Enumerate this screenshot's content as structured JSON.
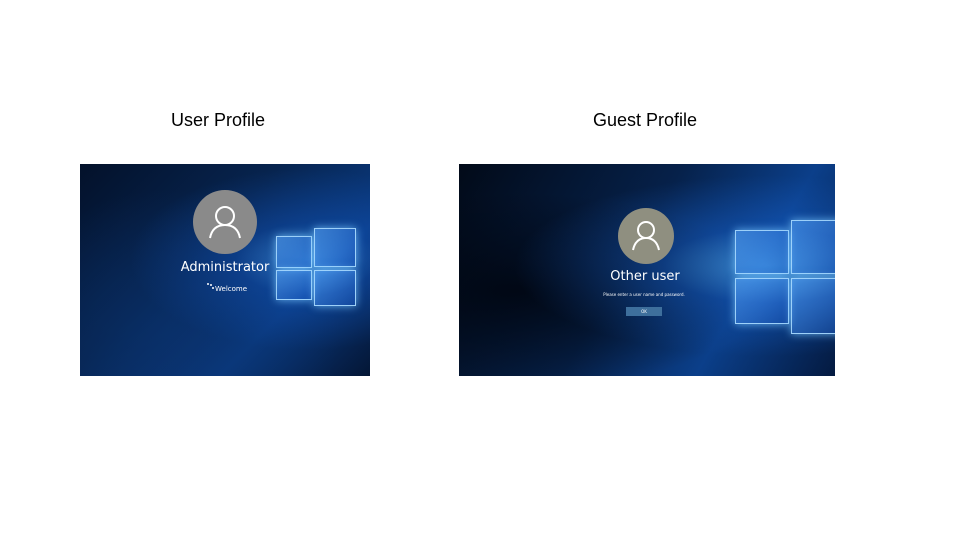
{
  "slide": {
    "user_caption": "User Profile",
    "guest_caption": "Guest Profile"
  },
  "user_screen": {
    "account_name": "Administrator",
    "status": "Welcome",
    "avatar_icon": "user-icon"
  },
  "guest_screen": {
    "account_name": "Other user",
    "prompt": "Please enter a user name and password.",
    "ok_label": "OK",
    "avatar_icon": "user-icon"
  },
  "colors": {
    "avatar_bg": "#8a8a8a",
    "ok_button_bg": "#3e6f9c"
  }
}
